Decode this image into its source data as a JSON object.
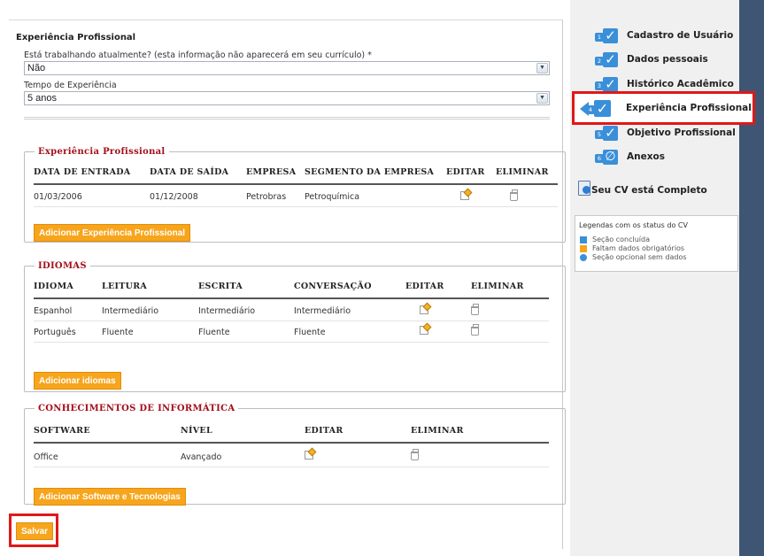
{
  "main": {
    "title": "Experiência Profissional",
    "question1": {
      "label": "Está trabalhando atualmente? (esta informação não aparecerá em seu currículo) *",
      "value": "Não"
    },
    "question2": {
      "label": "Tempo de Experiência",
      "value": "5 anos"
    },
    "save_label": "Salvar"
  },
  "experience": {
    "legend": "Experiência Profissional",
    "headers": [
      "DATA DE ENTRADA",
      "DATA DE SAÍDA",
      "EMPRESA",
      "SEGMENTO DA EMPRESA",
      "EDITAR",
      "ELIMINAR"
    ],
    "rows": [
      {
        "start": "01/03/2006",
        "end": "01/12/2008",
        "company": "Petrobras",
        "segment": "Petroquímica"
      }
    ],
    "add_label": "Adicionar Experiência Profissional"
  },
  "languages": {
    "legend": "IDIOMAS",
    "headers": [
      "IDIOMA",
      "LEITURA",
      "ESCRITA",
      "CONVERSAÇÃO",
      "EDITAR",
      "ELIMINAR"
    ],
    "rows": [
      {
        "language": "Espanhol",
        "reading": "Intermediário",
        "writing": "Intermediário",
        "speaking": "Intermediário"
      },
      {
        "language": "Português",
        "reading": "Fluente",
        "writing": "Fluente",
        "speaking": "Fluente"
      }
    ],
    "add_label": "Adicionar idiomas"
  },
  "software": {
    "legend": "CONHECIMENTOS DE INFORMÁTICA",
    "headers": [
      "SOFTWARE",
      "NÍVEL",
      "EDITAR",
      "ELIMINAR"
    ],
    "rows": [
      {
        "software": "Office",
        "level": "Avançado"
      }
    ],
    "add_label": "Adicionar Software e Tecnologias"
  },
  "sidebar": {
    "steps": [
      {
        "num": "1",
        "label": "Cadastro de Usuário",
        "status": "done"
      },
      {
        "num": "2",
        "label": "Dados pessoais",
        "status": "done"
      },
      {
        "num": "3",
        "label": "Histórico Acadêmico",
        "status": "done"
      },
      {
        "num": "4",
        "label": "Experiência Profissional",
        "status": "done",
        "active": true
      },
      {
        "num": "5",
        "label": "Objetivo Profissional",
        "status": "done"
      },
      {
        "num": "6",
        "label": "Anexos",
        "status": "optional-empty"
      }
    ],
    "complete_label": "Seu CV está Completo",
    "legend": {
      "title": "Legendas com os status do CV",
      "items": [
        {
          "text": "Seção concluída",
          "color": "#3a8fd9"
        },
        {
          "text": "Faltam dados obrigatórios",
          "color": "#f7a51c"
        },
        {
          "text": "Seção opcional sem dados",
          "color": "#3a8fd9"
        }
      ]
    }
  },
  "colors": {
    "accent": "#f7a51c",
    "section_title": "#a30f1a",
    "step_blue": "#3a8fd9",
    "highlight": "#e01818",
    "sidebar_dark": "#3e5673"
  }
}
